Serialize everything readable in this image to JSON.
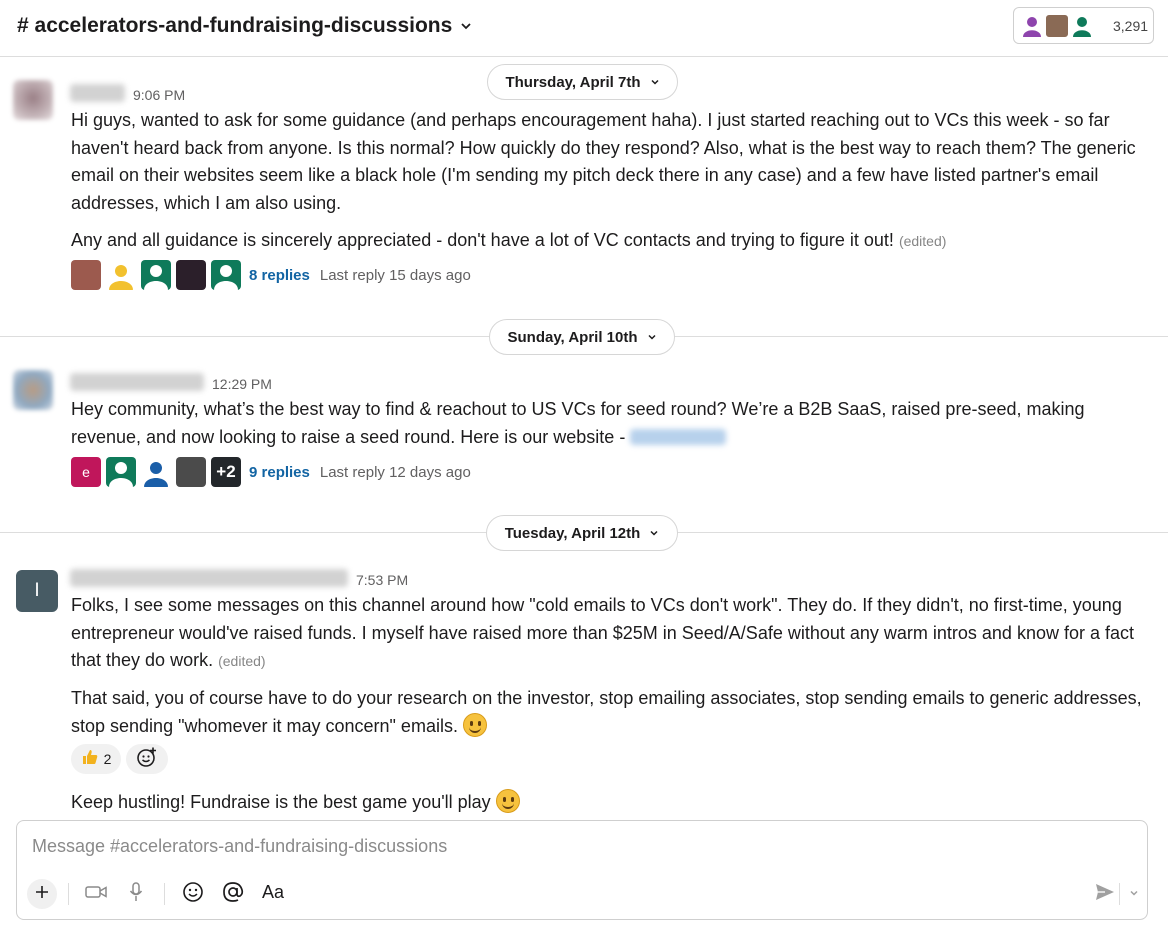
{
  "header": {
    "channel_title": "# accelerators-and-fundraising-discussions",
    "member_count": "3,291",
    "member_avatar_colors": [
      "#8e44ad",
      "#7a5c4a",
      "#0f7a5a"
    ]
  },
  "dates": [
    "Thursday, April 7th",
    "Sunday, April 10th",
    "Tuesday, April 12th"
  ],
  "messages": [
    {
      "time": "9:06 PM",
      "paragraphs": [
        "Hi guys, wanted to ask for some guidance (and perhaps encouragement haha). I just started reaching out to VCs this week - so far haven't heard back from anyone. Is this normal? How quickly do they respond? Also, what is the best way to reach them? The generic email on their websites seem like a black hole (I'm sending my pitch deck there in any case) and a few have listed partner's email addresses, which I am also using.",
        "Any and all guidance is sincerely appreciated - don't have a lot of VC contacts and trying to figure it out!"
      ],
      "edited_label": "(edited)",
      "replies": "8 replies",
      "last_reply": "Last reply 15 days ago"
    },
    {
      "time": "12:29 PM",
      "paragraphs": [
        "Hey community, what’s the best way to find & reachout to US VCs for seed round? We’re a B2B SaaS, raised pre-seed, making revenue, and now looking to raise a seed round. Here is our website -"
      ],
      "avatar_letter": "e",
      "more_count": "+2",
      "replies": "9 replies",
      "last_reply": "Last reply 12 days ago"
    },
    {
      "time": "7:53 PM",
      "avatar_initial": "I",
      "paragraphs": [
        "Folks, I see some messages on this channel around how \"cold emails to VCs don't work\". They do. If they didn't, no first-time, young entrepreneur would've raised funds. I myself have raised more than $25M in Seed/A/Safe without any warm intros and know for a fact that they do work.",
        "That said, you of course have to do your research on the investor, stop emailing associates, stop sending emails to generic addresses, stop sending \"whomever it may concern\" emails.",
        "Keep hustling! Fundraise is the best game you'll play"
      ],
      "edited_label": "(edited)",
      "reaction_count": "2"
    }
  ],
  "composer": {
    "placeholder": "Message #accelerators-and-fundraising-discussions"
  }
}
